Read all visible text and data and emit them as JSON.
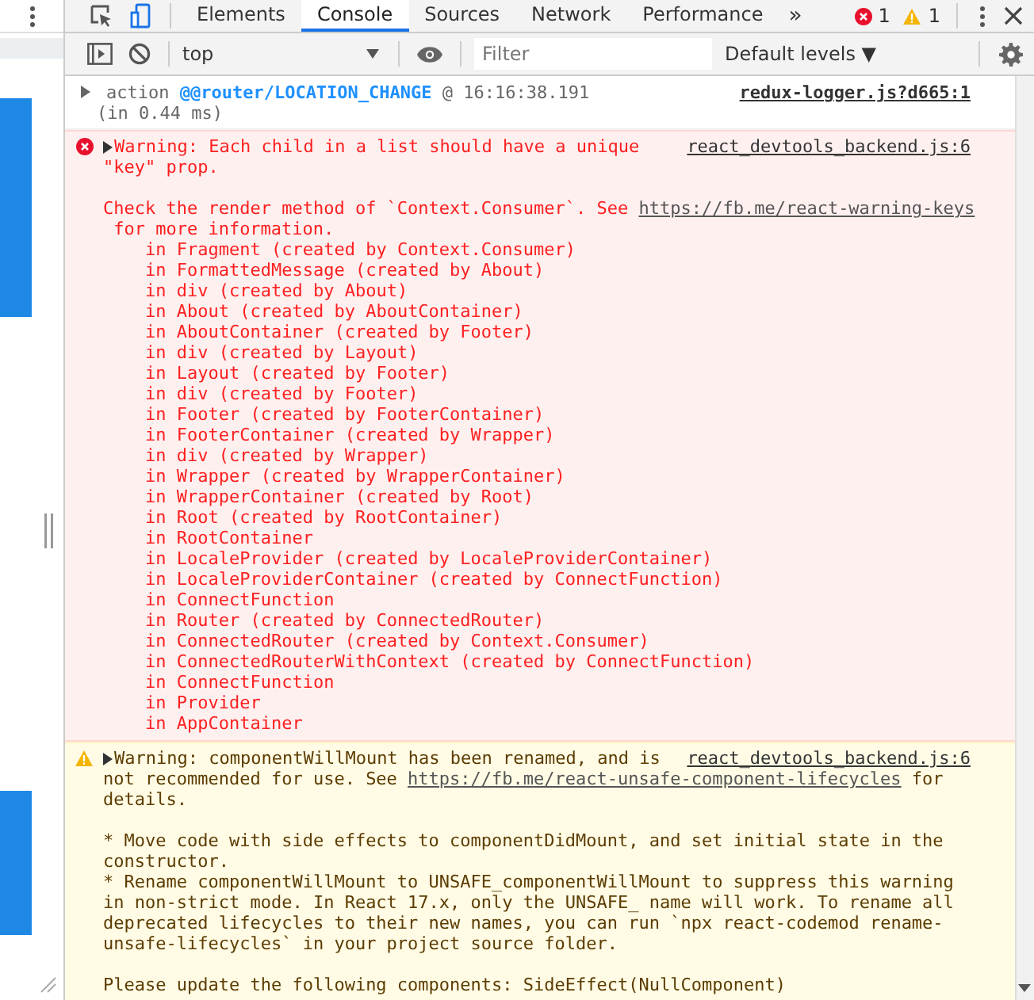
{
  "tabs": [
    {
      "label": "Elements",
      "selected": false
    },
    {
      "label": "Console",
      "selected": true
    },
    {
      "label": "Sources",
      "selected": false
    },
    {
      "label": "Network",
      "selected": false
    },
    {
      "label": "Performance",
      "selected": false
    }
  ],
  "more_tabs": "»",
  "error_count": "1",
  "warning_count": "1",
  "toolbar": {
    "context": "top",
    "filter_placeholder": "Filter",
    "levels": "Default levels ▼"
  },
  "messages": [
    {
      "kind": "info",
      "source": "redux-logger.js?d665:1",
      "lines": [
        {
          "kind": "text",
          "segments": [
            {
              "kind": "muted",
              "text": "action"
            },
            {
              "kind": "accent",
              "text": "@@router/LOCATION_CHANGE"
            },
            {
              "kind": "muted",
              "text": "@ 16:16:38.191"
            }
          ]
        },
        {
          "kind": "sub",
          "segments": [
            {
              "kind": "muted",
              "text": "(in 0.44 ms)"
            }
          ]
        }
      ]
    },
    {
      "kind": "error",
      "source": "react_devtools_backend.js:6",
      "lines": [
        {
          "kind": "text",
          "segments": [
            {
              "kind": "plain",
              "text": "Warning: Each child in a list should have a unique"
            }
          ]
        },
        {
          "kind": "text",
          "segments": [
            {
              "kind": "plain",
              "text": "\"key\" prop."
            }
          ]
        },
        {
          "kind": "blank"
        },
        {
          "kind": "text",
          "segments": [
            {
              "kind": "plain",
              "text": "Check the render method of `Context.Consumer`. See"
            },
            {
              "kind": "link",
              "text": "https://fb.me/react-warning-keys"
            }
          ]
        },
        {
          "kind": "wrap",
          "segments": [
            {
              "kind": "plain",
              "text": "for more information."
            }
          ]
        },
        {
          "kind": "stack",
          "segments": [
            {
              "kind": "plain",
              "text": "in Fragment (created by Context.Consumer)"
            }
          ]
        },
        {
          "kind": "stack",
          "segments": [
            {
              "kind": "plain",
              "text": "in FormattedMessage (created by About)"
            }
          ]
        },
        {
          "kind": "stack",
          "segments": [
            {
              "kind": "plain",
              "text": "in div (created by About)"
            }
          ]
        },
        {
          "kind": "stack",
          "segments": [
            {
              "kind": "plain",
              "text": "in About (created by AboutContainer)"
            }
          ]
        },
        {
          "kind": "stack",
          "segments": [
            {
              "kind": "plain",
              "text": "in AboutContainer (created by Footer)"
            }
          ]
        },
        {
          "kind": "stack",
          "segments": [
            {
              "kind": "plain",
              "text": "in div (created by Layout)"
            }
          ]
        },
        {
          "kind": "stack",
          "segments": [
            {
              "kind": "plain",
              "text": "in Layout (created by Footer)"
            }
          ]
        },
        {
          "kind": "stack",
          "segments": [
            {
              "kind": "plain",
              "text": "in div (created by Footer)"
            }
          ]
        },
        {
          "kind": "stack",
          "segments": [
            {
              "kind": "plain",
              "text": "in Footer (created by FooterContainer)"
            }
          ]
        },
        {
          "kind": "stack",
          "segments": [
            {
              "kind": "plain",
              "text": "in FooterContainer (created by Wrapper)"
            }
          ]
        },
        {
          "kind": "stack",
          "segments": [
            {
              "kind": "plain",
              "text": "in div (created by Wrapper)"
            }
          ]
        },
        {
          "kind": "stack",
          "segments": [
            {
              "kind": "plain",
              "text": "in Wrapper (created by WrapperContainer)"
            }
          ]
        },
        {
          "kind": "stack",
          "segments": [
            {
              "kind": "plain",
              "text": "in WrapperContainer (created by Root)"
            }
          ]
        },
        {
          "kind": "stack",
          "segments": [
            {
              "kind": "plain",
              "text": "in Root (created by RootContainer)"
            }
          ]
        },
        {
          "kind": "stack",
          "segments": [
            {
              "kind": "plain",
              "text": "in RootContainer"
            }
          ]
        },
        {
          "kind": "stack",
          "segments": [
            {
              "kind": "plain",
              "text": "in LocaleProvider (created by LocaleProviderContainer)"
            }
          ]
        },
        {
          "kind": "stack",
          "segments": [
            {
              "kind": "plain",
              "text": "in LocaleProviderContainer (created by ConnectFunction)"
            }
          ]
        },
        {
          "kind": "stack",
          "segments": [
            {
              "kind": "plain",
              "text": "in ConnectFunction"
            }
          ]
        },
        {
          "kind": "stack",
          "segments": [
            {
              "kind": "plain",
              "text": "in Router (created by ConnectedRouter)"
            }
          ]
        },
        {
          "kind": "stack",
          "segments": [
            {
              "kind": "plain",
              "text": "in ConnectedRouter (created by Context.Consumer)"
            }
          ]
        },
        {
          "kind": "stack",
          "segments": [
            {
              "kind": "plain",
              "text": "in ConnectedRouterWithContext (created by ConnectFunction)"
            }
          ]
        },
        {
          "kind": "stack",
          "segments": [
            {
              "kind": "plain",
              "text": "in ConnectFunction"
            }
          ]
        },
        {
          "kind": "stack",
          "segments": [
            {
              "kind": "plain",
              "text": "in Provider"
            }
          ]
        },
        {
          "kind": "stack",
          "segments": [
            {
              "kind": "plain",
              "text": "in AppContainer"
            }
          ]
        }
      ]
    },
    {
      "kind": "warning",
      "source": "react_devtools_backend.js:6",
      "lines": [
        {
          "kind": "text",
          "segments": [
            {
              "kind": "plain",
              "text": "Warning: componentWillMount has been renamed, and is"
            }
          ]
        },
        {
          "kind": "text",
          "segments": [
            {
              "kind": "plain",
              "text": "not recommended for use. See"
            },
            {
              "kind": "link",
              "text": "https://fb.me/react-unsafe-component-lifecycles"
            },
            {
              "kind": "plain",
              "text": "for"
            }
          ]
        },
        {
          "kind": "text",
          "segments": [
            {
              "kind": "plain",
              "text": "details."
            }
          ]
        },
        {
          "kind": "blank"
        },
        {
          "kind": "text",
          "segments": [
            {
              "kind": "plain",
              "text": "* Move code with side effects to componentDidMount, and set initial state in the"
            }
          ]
        },
        {
          "kind": "text",
          "segments": [
            {
              "kind": "plain",
              "text": "constructor."
            }
          ]
        },
        {
          "kind": "text",
          "segments": [
            {
              "kind": "plain",
              "text": "* Rename componentWillMount to UNSAFE_componentWillMount to suppress this warning"
            }
          ]
        },
        {
          "kind": "text",
          "segments": [
            {
              "kind": "plain",
              "text": "in non-strict mode. In React 17.x, only the UNSAFE_ name will work. To rename all"
            }
          ]
        },
        {
          "kind": "text",
          "segments": [
            {
              "kind": "plain",
              "text": "deprecated lifecycles to their new names, you can run `npx react-codemod rename-"
            }
          ]
        },
        {
          "kind": "text",
          "segments": [
            {
              "kind": "plain",
              "text": "unsafe-lifecycles` in your project source folder."
            }
          ]
        },
        {
          "kind": "blank"
        },
        {
          "kind": "text",
          "segments": [
            {
              "kind": "plain",
              "text": "Please update the following components: SideEffect(NullComponent)"
            }
          ]
        }
      ]
    }
  ]
}
